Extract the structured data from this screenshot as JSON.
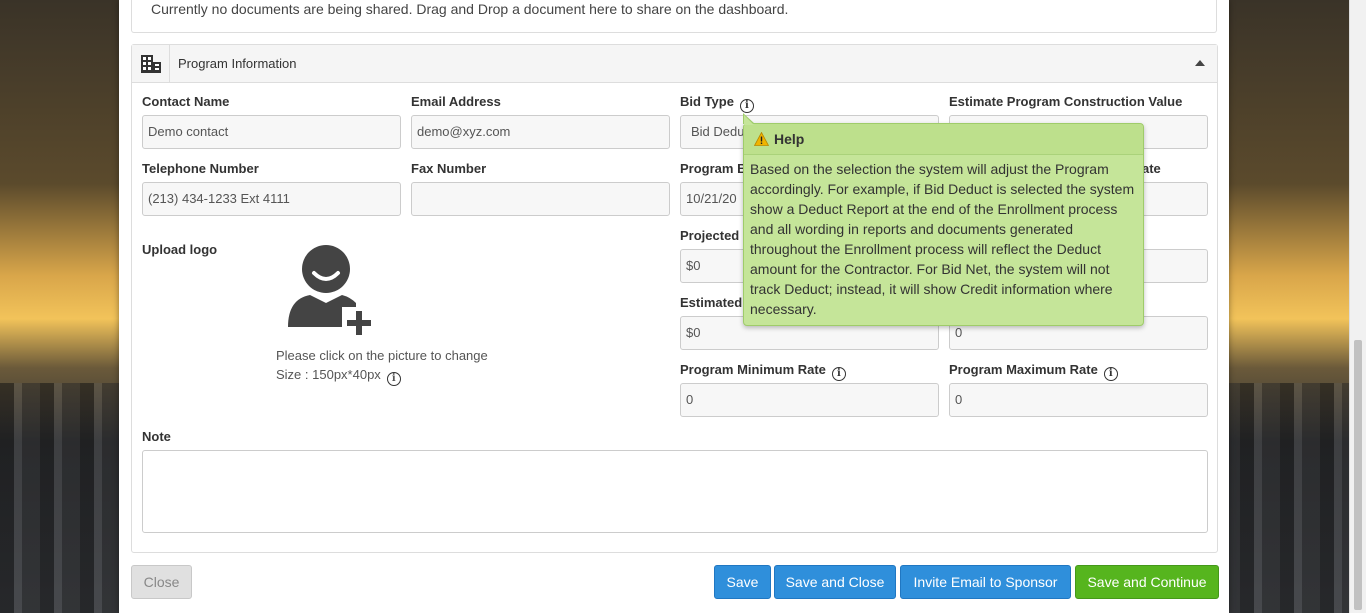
{
  "documents": {
    "empty_text": "Currently no documents are being shared. Drag and Drop a document here to share on the dashboard."
  },
  "section": {
    "title": "Program Information",
    "icon": "building-icon",
    "toggle_icon": "caret-up-icon"
  },
  "fields": {
    "contact_name": {
      "label": "Contact Name",
      "value": "Demo contact"
    },
    "email": {
      "label": "Email Address",
      "value": "demo@xyz.com"
    },
    "bid_type": {
      "label": "Bid Type",
      "value": "Bid Deduct"
    },
    "estimate_value": {
      "label": "Estimate Program Construction Value",
      "value": ""
    },
    "telephone": {
      "label": "Telephone Number",
      "value": "(213) 434-1233 Ext 4111"
    },
    "fax": {
      "label": "Fax Number",
      "value": ""
    },
    "program_begin": {
      "label": "Program Be",
      "value": "10/21/20"
    },
    "date_right": {
      "label": "ate",
      "value": ""
    },
    "projected": {
      "label": "Projected L",
      "value": "$0"
    },
    "projected_right": {
      "value": ""
    },
    "estimated": {
      "label": "Estimated",
      "value": "$0"
    },
    "estimated_right": {
      "value": "0"
    },
    "min_rate": {
      "label": "Program Minimum Rate",
      "value": "0"
    },
    "max_rate": {
      "label": "Program Maximum Rate",
      "value": "0"
    },
    "note": {
      "label": "Note",
      "value": ""
    }
  },
  "logo": {
    "label": "Upload logo",
    "hint": "Please click on the picture to change",
    "size": "Size : 150px*40px"
  },
  "tooltip": {
    "title": "Help",
    "body": "Based on the selection the system will adjust the Program accordingly. For example, if Bid Deduct is selected the system show a Deduct Report at the end of the Enrollment process and all wording in reports and documents generated throughout the Enrollment process will reflect the Deduct amount for the Contractor. For Bid Net, the system will not track Deduct; instead, it will show Credit information where necessary."
  },
  "buttons": {
    "close": "Close",
    "save": "Save",
    "save_close": "Save and Close",
    "invite": "Invite Email to Sponsor",
    "save_continue": "Save and Continue"
  },
  "colors": {
    "primary": "#2f8fdb",
    "success": "#56b51e",
    "tooltip_bg": "#c5e599"
  }
}
